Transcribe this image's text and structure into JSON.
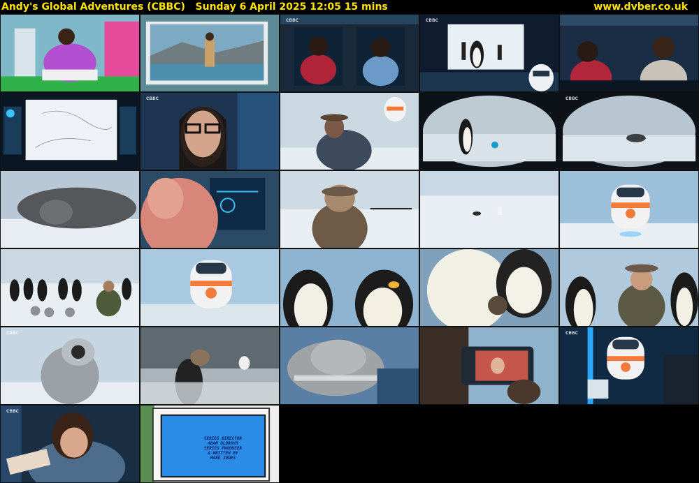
{
  "header": {
    "programme": "Andy's Global Adventures (CBBC)",
    "schedule": "Sunday 6 April 2025  12:05  15 mins",
    "site": "www.dvber.co.uk"
  },
  "overlay": {
    "channel_logo": "CBBC",
    "credits": [
      "SERIES DIRECTOR",
      "ADAM OLDROYD",
      "SERIES PRODUCER",
      "& WRITTEN BY",
      "MARK JONES"
    ]
  },
  "thumbnails": [
    {
      "scene": "Andy in purple scrubs in hospital bed"
    },
    {
      "scene": "Explorer waving in framed picture"
    },
    {
      "scene": "Two presenters in control room"
    },
    {
      "scene": "Penguin screen in control room with robot"
    },
    {
      "scene": "Presenters at control console"
    },
    {
      "scene": "Map of Antarctica on monitor"
    },
    {
      "scene": "Presenter with glasses close-up"
    },
    {
      "scene": "Explorer in fur hood with robot"
    },
    {
      "scene": "Emperor penguin through goggles view"
    },
    {
      "scene": "Seal through goggles view"
    },
    {
      "scene": "Seal resting on ice"
    },
    {
      "scene": "Presenter at handheld device"
    },
    {
      "scene": "Explorer facing distant penguin colony"
    },
    {
      "scene": "Tiny penguins on ice plain"
    },
    {
      "scene": "Hovering robot over ice"
    },
    {
      "scene": "Explorer kneeling by penguin colony"
    },
    {
      "scene": "Hovering robot close-up"
    },
    {
      "scene": "Emperor penguins close-up"
    },
    {
      "scene": "Penguin feeding chick"
    },
    {
      "scene": "Explorer among emperor penguins"
    },
    {
      "scene": "Fluffy penguin chick"
    },
    {
      "scene": "Explorer in misty penguin colony"
    },
    {
      "scene": "Frosted hat close-up"
    },
    {
      "scene": "Handheld video device"
    },
    {
      "scene": "Robot in control room"
    },
    {
      "scene": "Andy with notepad in control room"
    },
    {
      "scene": "End credits on screen"
    }
  ]
}
